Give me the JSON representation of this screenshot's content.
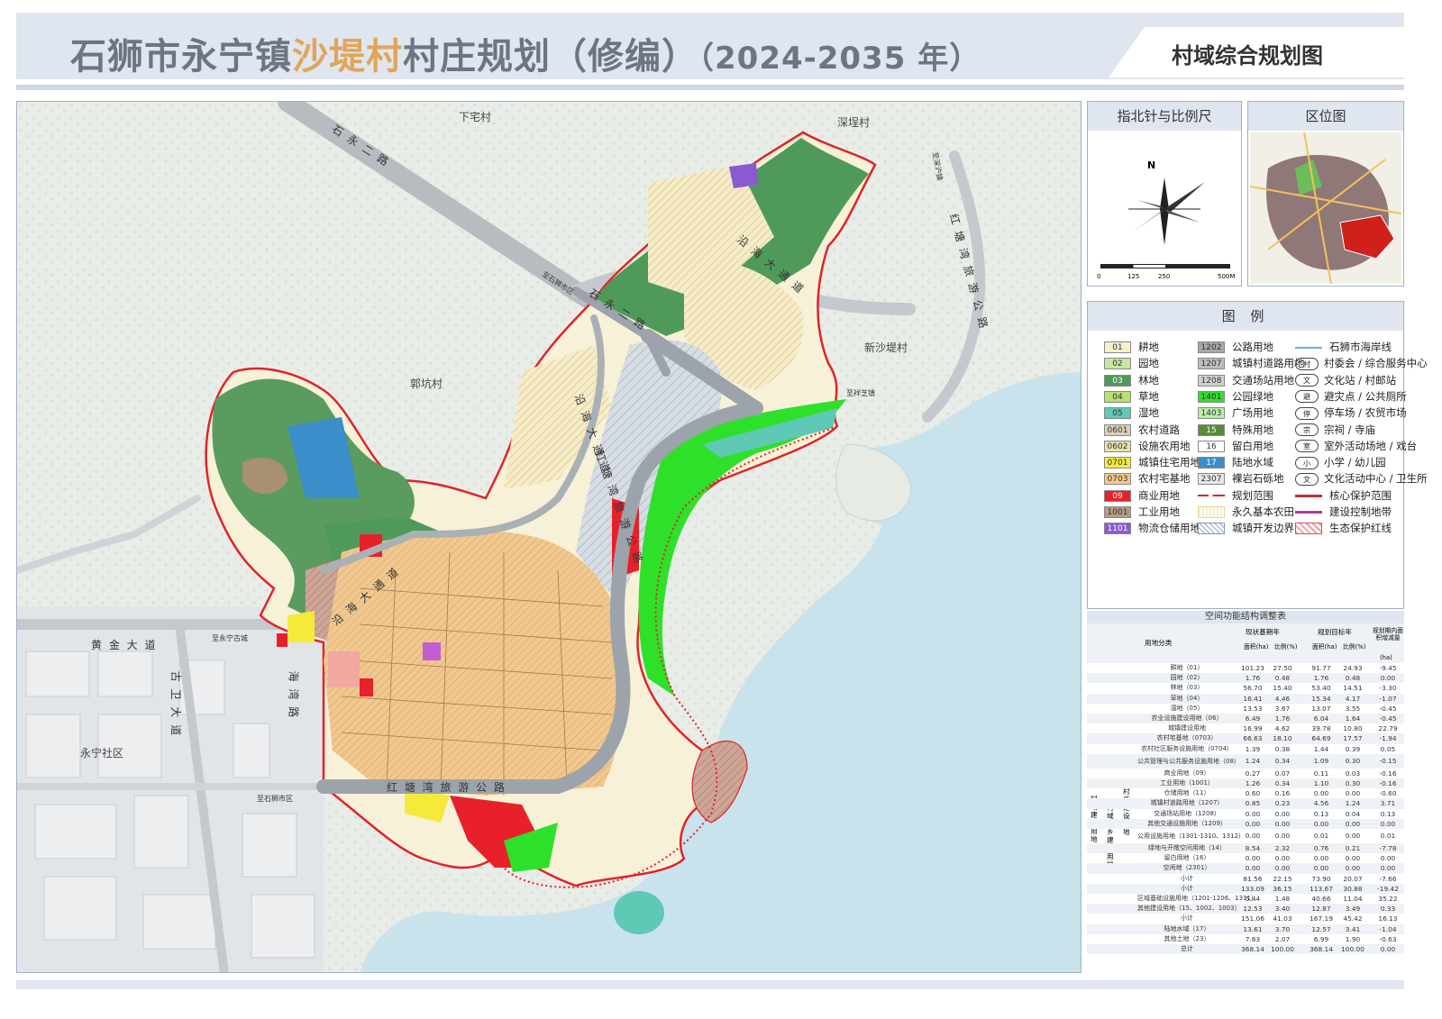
{
  "header": {
    "title_prefix": "石狮市永宁镇",
    "title_highlight": "沙堤村",
    "title_suffix": "村庄规划（修编）",
    "title_years": "（2024-2035 年）",
    "subtitle": "村域综合规划图"
  },
  "map": {
    "places": [
      "下宅村",
      "深埕村",
      "郭坑村",
      "新沙堤村",
      "永宁社区"
    ],
    "roads": {
      "shiyong": "石 永 二 路",
      "shiyong2": "石 永 二 路",
      "yanhai": "沿 海 大 通 道",
      "yanhai2": "沿 海 大 通 道",
      "hongtang_v": "红 塘 湾 旅 游 公 路",
      "hongtang_h": "红 塘 湾 旅 游 公 路",
      "huangjin": "黄 金 大 道",
      "guwei": "古 卫 大 道",
      "haiwan": "海 湾 路",
      "hongtang_ne": "红 塘 湾 旅 游 公 路",
      "yanhai3": "沿 海 大 通 道"
    },
    "direction_signs": [
      "至石狮市区",
      "至深沪镇",
      "至永宁古城",
      "至祥芝镇",
      "至石狮市区"
    ]
  },
  "compass": {
    "heading": "指北针与比例尺",
    "north": "N",
    "scale_ticks": [
      "0",
      "125",
      "250",
      "500M"
    ]
  },
  "location": {
    "heading": "区位图"
  },
  "legend": {
    "heading": "图 例",
    "col1": [
      {
        "code": "01",
        "label": "耕地",
        "color": "#f5f0c8"
      },
      {
        "code": "02",
        "label": "园地",
        "color": "#c8e6a0"
      },
      {
        "code": "03",
        "label": "林地",
        "color": "#4f9a5a"
      },
      {
        "code": "04",
        "label": "草地",
        "color": "#b8e06c"
      },
      {
        "code": "05",
        "label": "湿地",
        "color": "#5ec9b4"
      },
      {
        "code": "0601",
        "label": "农村道路",
        "color": "#d8d0b8"
      },
      {
        "code": "0602",
        "label": "设施农用地",
        "color": "#e8e0a8"
      },
      {
        "code": "0701",
        "label": "城镇住宅用地",
        "color": "#f5e93a"
      },
      {
        "code": "0703",
        "label": "农村宅基地",
        "color": "#f2c98a"
      },
      {
        "code": "09",
        "label": "商业用地",
        "color": "#e8202a"
      },
      {
        "code": "1001",
        "label": "工业用地",
        "color": "#b59a88"
      },
      {
        "code": "1101",
        "label": "物流仓储用地",
        "color": "#8a5ad0"
      }
    ],
    "col2": [
      {
        "code": "1202",
        "label": "公路用地",
        "color": "#a8a8a8"
      },
      {
        "code": "1207",
        "label": "城镇村道路用地",
        "color": "#bdbdbd"
      },
      {
        "code": "1208",
        "label": "交通场站用地",
        "color": "#d0d0d0"
      },
      {
        "code": "1401",
        "label": "公园绿地",
        "color": "#2fe02a"
      },
      {
        "code": "1403",
        "label": "广场用地",
        "color": "#b8f0a8"
      },
      {
        "code": "15",
        "label": "特殊用地",
        "color": "#5a8a3a"
      },
      {
        "code": "16",
        "label": "留白用地",
        "color": "#ffffff"
      },
      {
        "code": "17",
        "label": "陆地水域",
        "color": "#3a8ec9"
      },
      {
        "code": "2307",
        "label": "裸岩石砾地",
        "color": "#e6e6e6"
      },
      {
        "code": "",
        "label": "规划范围",
        "color": ""
      },
      {
        "code": "",
        "label": "永久基本农田",
        "color": ""
      },
      {
        "code": "",
        "label": "城镇开发边界",
        "color": ""
      }
    ],
    "col3": [
      {
        "icon": "",
        "label": "石狮市海岸线"
      },
      {
        "icon": "村",
        "label": "村委会 / 综合服务中心"
      },
      {
        "icon": "文",
        "label": "文化站 / 村邮站"
      },
      {
        "icon": "避",
        "label": "避灾点 / 公共厕所"
      },
      {
        "icon": "停",
        "label": "停车场 / 农贸市场"
      },
      {
        "icon": "宗",
        "label": "宗祠 / 寺庙"
      },
      {
        "icon": "室",
        "label": "室外活动场地 / 戏台"
      },
      {
        "icon": "小",
        "label": "小学 / 幼儿园"
      },
      {
        "icon": "文",
        "label": "文化活动中心 / 卫生所"
      },
      {
        "icon": "",
        "label": "核心保护范围"
      },
      {
        "icon": "",
        "label": "建设控制地带"
      },
      {
        "icon": "",
        "label": "生态保护红线"
      }
    ]
  },
  "table": {
    "title": "空间功能结构调整表",
    "head": {
      "category": "用地分类",
      "current": "现状基期年",
      "target": "规划目标年",
      "change": "规划期内面积增减量",
      "area": "面积(ha)",
      "ratio": "比例(%)",
      "change_unit": "(ha)"
    },
    "vertical_labels": {
      "outer": "村域建设用地",
      "mid": "村域城乡建设用地",
      "inner": "村庄建设用地"
    },
    "rows": [
      {
        "name": "耕地（01）",
        "a1": "101.23",
        "r1": "27.50",
        "a2": "91.77",
        "r2": "24.93",
        "d": "-9.45"
      },
      {
        "name": "园地（02）",
        "a1": "1.76",
        "r1": "0.48",
        "a2": "1.76",
        "r2": "0.48",
        "d": "0.00"
      },
      {
        "name": "林地（03）",
        "a1": "56.70",
        "r1": "15.40",
        "a2": "53.40",
        "r2": "14.51",
        "d": "-3.30"
      },
      {
        "name": "草地（04）",
        "a1": "16.41",
        "r1": "4.46",
        "a2": "15.34",
        "r2": "4.17",
        "d": "-1.07"
      },
      {
        "name": "湿地（05）",
        "a1": "13.53",
        "r1": "3.67",
        "a2": "13.07",
        "r2": "3.55",
        "d": "-0.45"
      },
      {
        "name": "农业设施建设用地（06）",
        "a1": "6.49",
        "r1": "1.76",
        "a2": "6.04",
        "r2": "1.64",
        "d": "-0.45"
      },
      {
        "name": "城镇建设用地",
        "a1": "16.99",
        "r1": "4.62",
        "a2": "39.78",
        "r2": "10.80",
        "d": "22.79"
      },
      {
        "name": "农村宅基地（0703）",
        "a1": "66.63",
        "r1": "18.10",
        "a2": "64.69",
        "r2": "17.57",
        "d": "-1.94"
      },
      {
        "name": "农村社区服务设施用地（0704）",
        "a1": "1.39",
        "r1": "0.38",
        "a2": "1.44",
        "r2": "0.39",
        "d": "0.05"
      },
      {
        "name": "公共管理与公共服务设施用地（08）",
        "a1": "1.24",
        "r1": "0.34",
        "a2": "1.09",
        "r2": "0.30",
        "d": "-0.15",
        "tall": true
      },
      {
        "name": "商业用地（09）",
        "a1": "0.27",
        "r1": "0.07",
        "a2": "0.11",
        "r2": "0.03",
        "d": "-0.16"
      },
      {
        "name": "工业用地（1001）",
        "a1": "1.26",
        "r1": "0.34",
        "a2": "1.10",
        "r2": "0.30",
        "d": "-0.16"
      },
      {
        "name": "仓储用地（11）",
        "a1": "0.60",
        "r1": "0.16",
        "a2": "0.00",
        "r2": "0.00",
        "d": "-0.60"
      },
      {
        "name": "城镇村道路用地（1207）",
        "a1": "0.85",
        "r1": "0.23",
        "a2": "4.56",
        "r2": "1.24",
        "d": "3.71"
      },
      {
        "name": "交通场站用地（1208）",
        "a1": "0.00",
        "r1": "0.00",
        "a2": "0.13",
        "r2": "0.04",
        "d": "0.13"
      },
      {
        "name": "其他交通设施用地（1209）",
        "a1": "0.00",
        "r1": "0.00",
        "a2": "0.00",
        "r2": "0.00",
        "d": "0.00"
      },
      {
        "name": "公用设施用地（1301-1310、1312）",
        "a1": "0.00",
        "r1": "0.00",
        "a2": "0.01",
        "r2": "0.00",
        "d": "0.01",
        "tall": true
      },
      {
        "name": "绿地与开敞空间用地（14）",
        "a1": "8.54",
        "r1": "2.32",
        "a2": "0.76",
        "r2": "0.21",
        "d": "-7.78"
      },
      {
        "name": "留白用地（16）",
        "a1": "0.00",
        "r1": "0.00",
        "a2": "0.00",
        "r2": "0.00",
        "d": "0.00"
      },
      {
        "name": "空闲地（2301）",
        "a1": "0.00",
        "r1": "0.00",
        "a2": "0.00",
        "r2": "0.00",
        "d": "0.00"
      },
      {
        "name": "小计",
        "a1": "81.56",
        "r1": "22.15",
        "a2": "73.90",
        "r2": "20.07",
        "d": "-7.66"
      },
      {
        "name": "小计",
        "a1": "133.09",
        "r1": "36.15",
        "a2": "113.67",
        "r2": "30.88",
        "d": "-19.42"
      },
      {
        "name": "区域基础设施用地（1201-1206、1311）",
        "a1": "5.44",
        "r1": "1.48",
        "a2": "40.66",
        "r2": "11.04",
        "d": "35.22"
      },
      {
        "name": "其他建设用地（15、1002、1003）",
        "a1": "12.53",
        "r1": "3.40",
        "a2": "12.87",
        "r2": "3.49",
        "d": "0.33"
      },
      {
        "name": "小计",
        "a1": "151.06",
        "r1": "41.03",
        "a2": "167.19",
        "r2": "45.42",
        "d": "16.13"
      },
      {
        "name": "陆地水域（17）",
        "a1": "13.61",
        "r1": "3.70",
        "a2": "12.57",
        "r2": "3.41",
        "d": "-1.04"
      },
      {
        "name": "其他土地（23）",
        "a1": "7.63",
        "r1": "2.07",
        "a2": "6.99",
        "r2": "1.90",
        "d": "-0.63"
      },
      {
        "name": "总计",
        "a1": "368.14",
        "r1": "100.00",
        "a2": "368.14",
        "r2": "100.00",
        "d": "0.00"
      }
    ]
  }
}
